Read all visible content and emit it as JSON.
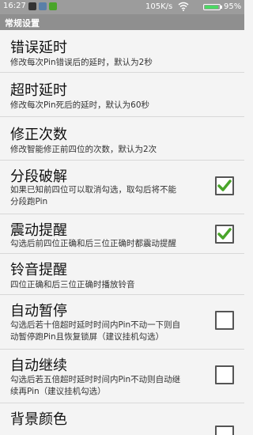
{
  "status_bar": {
    "time": "16:27",
    "speed": "105K/s",
    "battery": "95%",
    "battery_level": 0.95
  },
  "app_bar": {
    "title": "常规设置"
  },
  "settings": [
    {
      "title": "错误延时",
      "summary": "修改每次Pin错误后的延时，默认为2秒"
    },
    {
      "title": "超时延时",
      "summary": "修改每次Pin死后的延时，默认为60秒"
    },
    {
      "title": "修正次数",
      "summary": "修改智能修正前四位的次数，默认为2次"
    },
    {
      "title": "分段破解",
      "summary_line1": "如果已知前四位可以取消勾选，取勾后将不能",
      "summary_line2": "分段跑Pin",
      "checked": true
    },
    {
      "title": "震动提醒",
      "summary": "勾选后前四位正确和后三位正确时都震动提醒",
      "checked": true
    },
    {
      "title": "铃音提醒",
      "summary": "四位正确和后三位正确时播放铃音"
    },
    {
      "title": "自动暂停",
      "summary_line1": "勾选后若十倍超时延时时间内Pin不动一下则自",
      "summary_line2": "动暂停跑Pin且恢复锁屏（建议挂机勾选）",
      "checked": false
    },
    {
      "title": "自动继续",
      "summary_line1": "勾选后若五倍超时延时时间内Pin不动则自动继",
      "summary_line2": "续再Pin（建议挂机勾选）",
      "checked": false
    },
    {
      "title": "背景颜色",
      "checked": false
    }
  ],
  "colors": {
    "check_green": "#4aa52a",
    "status_bar": "#9c9c9c",
    "app_bar": "#8f8f8f"
  }
}
